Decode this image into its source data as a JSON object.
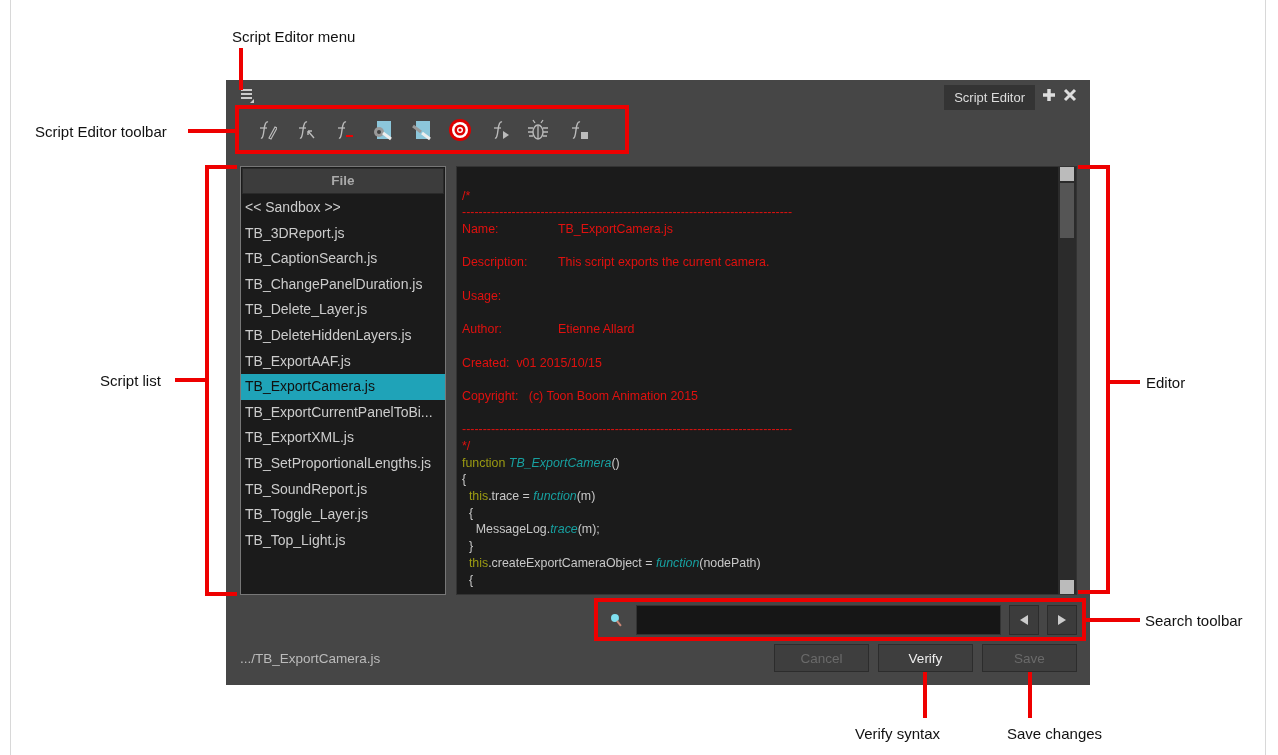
{
  "callouts": [
    {
      "text": "Script Editor menu",
      "kind": "menu"
    },
    {
      "text": "Script Editor toolbar",
      "kind": "toolbar"
    },
    {
      "text": "Script list",
      "kind": "list"
    },
    {
      "text": "Editor",
      "kind": "editor"
    },
    {
      "text": "Search toolbar",
      "kind": "search"
    },
    {
      "text": "Verify syntax",
      "kind": "verify"
    },
    {
      "text": "Save changes",
      "kind": "save"
    }
  ],
  "window": {
    "tab": {
      "label": "Script Editor",
      "selected": true
    }
  },
  "script_list": {
    "header": "File",
    "items": [
      {
        "label": "<< Sandbox >>",
        "selected": false
      },
      {
        "label": "TB_3DReport.js",
        "selected": false
      },
      {
        "label": "TB_CaptionSearch.js",
        "selected": false
      },
      {
        "label": "TB_ChangePanelDuration.js",
        "selected": false
      },
      {
        "label": "TB_Delete_Layer.js",
        "selected": false
      },
      {
        "label": "TB_DeleteHiddenLayers.js",
        "selected": false
      },
      {
        "label": "TB_ExportAAF.js",
        "selected": false
      },
      {
        "label": "TB_ExportCamera.js",
        "selected": true
      },
      {
        "label": "TB_ExportCurrentPanelToBi...",
        "selected": false
      },
      {
        "label": "TB_ExportXML.js",
        "selected": false
      },
      {
        "label": "TB_SetProportionalLengths.js",
        "selected": false
      },
      {
        "label": "TB_SoundReport.js",
        "selected": false
      },
      {
        "label": "TB_Toggle_Layer.js",
        "selected": false
      },
      {
        "label": "TB_Top_Light.js",
        "selected": false
      }
    ]
  },
  "editor": {
    "lines": [
      {
        "kind": "blank"
      },
      {
        "kind": "comment",
        "text": "/*"
      },
      {
        "kind": "comment",
        "text": "--------------------------------------------------------------------------------"
      },
      {
        "kind": "field",
        "label": "Name:",
        "value": "TB_ExportCamera.js"
      },
      {
        "kind": "blank"
      },
      {
        "kind": "field",
        "label": "Description:",
        "value": "This script exports the current camera."
      },
      {
        "kind": "blank"
      },
      {
        "kind": "field",
        "label": "Usage:"
      },
      {
        "kind": "blank"
      },
      {
        "kind": "field",
        "label": "Author:",
        "value": "Etienne Allard"
      },
      {
        "kind": "blank"
      },
      {
        "kind": "comment",
        "text": "Created:  v01 2015/10/15"
      },
      {
        "kind": "blank"
      },
      {
        "kind": "comment",
        "text": "Copyright:   (c) Toon Boom Animation 2015"
      },
      {
        "kind": "blank"
      },
      {
        "kind": "comment",
        "text": "--------------------------------------------------------------------------------"
      },
      {
        "kind": "comment",
        "text": "*/"
      },
      {
        "kind": "code",
        "segments": [
          {
            "text": "function ",
            "kind": "keyword"
          },
          {
            "text": "TB_ExportCamera",
            "kind": "name"
          },
          {
            "text": "()",
            "kind": "plain"
          }
        ]
      },
      {
        "kind": "code",
        "segments": [
          {
            "text": "{",
            "kind": "plain"
          }
        ]
      },
      {
        "kind": "code",
        "segments": [
          {
            "text": "  this",
            "kind": "keyword"
          },
          {
            "text": ".trace = ",
            "kind": "plain"
          },
          {
            "text": "function",
            "kind": "name"
          },
          {
            "text": "(m)",
            "kind": "plain"
          }
        ]
      },
      {
        "kind": "code",
        "segments": [
          {
            "text": "  {",
            "kind": "plain"
          }
        ]
      },
      {
        "kind": "code",
        "segments": [
          {
            "text": "    MessageLog.",
            "kind": "plain"
          },
          {
            "text": "trace",
            "kind": "name"
          },
          {
            "text": "(m);",
            "kind": "plain"
          }
        ]
      },
      {
        "kind": "code",
        "segments": [
          {
            "text": "  }",
            "kind": "plain"
          }
        ]
      },
      {
        "kind": "code",
        "segments": [
          {
            "text": "  this",
            "kind": "keyword"
          },
          {
            "text": ".createExportCameraObject = ",
            "kind": "plain"
          },
          {
            "text": "function",
            "kind": "name"
          },
          {
            "text": "(nodePath)",
            "kind": "plain"
          }
        ]
      },
      {
        "kind": "code",
        "segments": [
          {
            "text": "  {",
            "kind": "plain"
          }
        ]
      }
    ]
  },
  "status_path": ".../TB_ExportCamera.js",
  "buttons": [
    {
      "label": "Cancel",
      "disabled": true
    },
    {
      "label": "Verify",
      "disabled": false
    },
    {
      "label": "Save",
      "disabled": true
    }
  ]
}
